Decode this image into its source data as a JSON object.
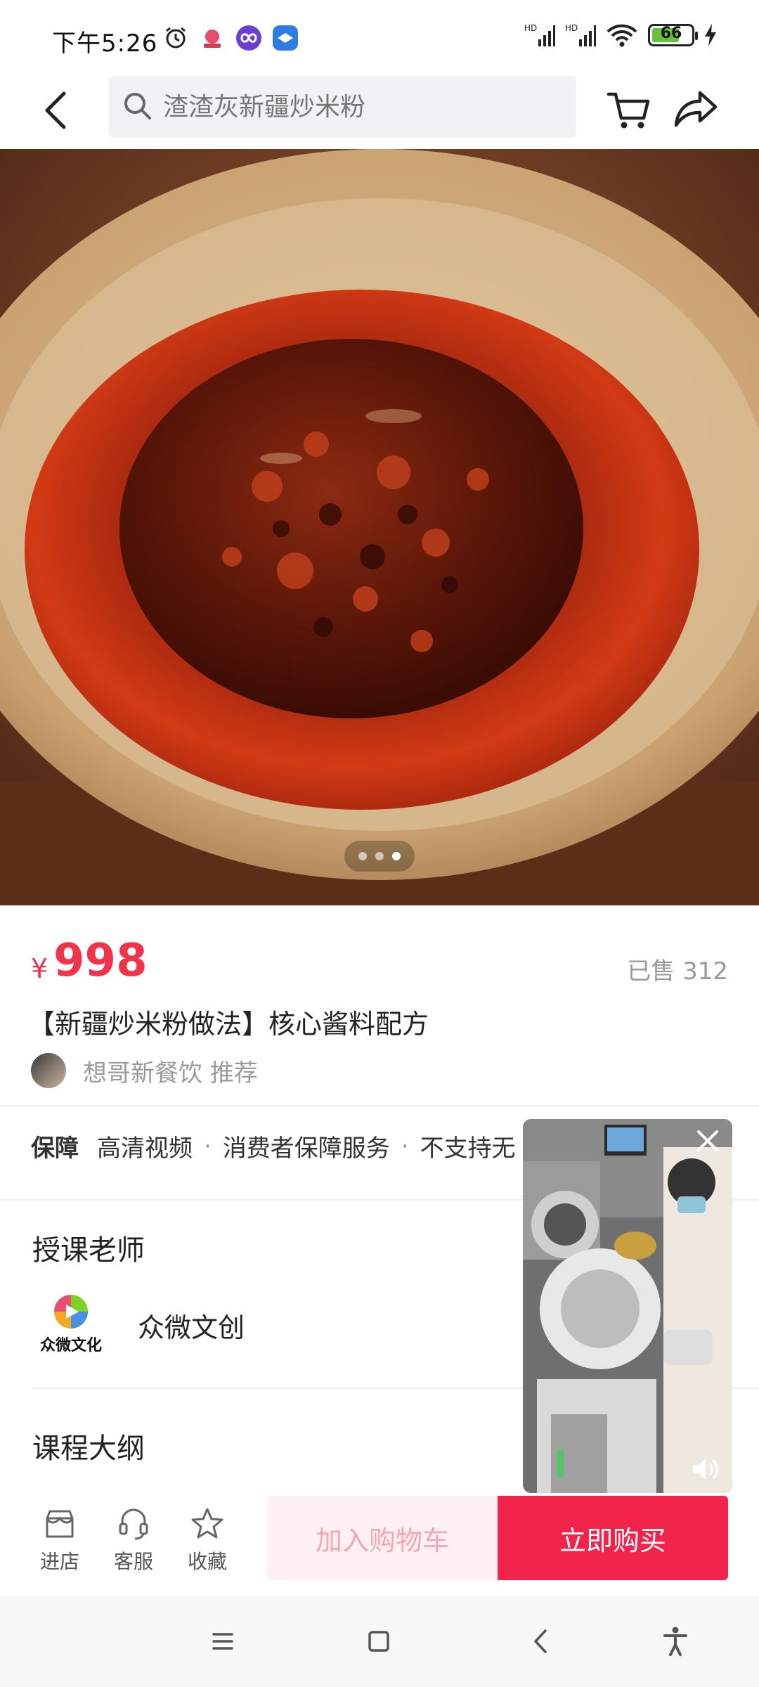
{
  "status_bar": {
    "time": "下午5:26",
    "network_1": "HD",
    "network_2": "HD",
    "battery": "66"
  },
  "header": {
    "search_placeholder": "渣渣灰新疆炒米粉"
  },
  "carousel": {
    "pages": 3,
    "active_index": 2
  },
  "product": {
    "price_symbol": "¥",
    "price": "998",
    "sold": "已售 312",
    "title": "【新疆炒米粉做法】核心酱料配方",
    "recommender": "想哥新餐饮 推荐"
  },
  "guarantee": {
    "label": "保障",
    "items": [
      "高清视频",
      "消费者保障服务",
      "不支持无"
    ],
    "separator": "·"
  },
  "teacher": {
    "section_title": "授课老师",
    "name": "众微文创",
    "logo_text": "众微文化"
  },
  "outline": {
    "section_title": "课程大纲"
  },
  "bottom_bar": {
    "shop_label": "进店",
    "service_label": "客服",
    "favorite_label": "收藏",
    "add_cart_label": "加入购物车",
    "buy_now_label": "立即购买"
  },
  "colors": {
    "accent": "#f0344c",
    "buy_button": "#f3244b",
    "add_cart_bg": "#fff1f3"
  }
}
